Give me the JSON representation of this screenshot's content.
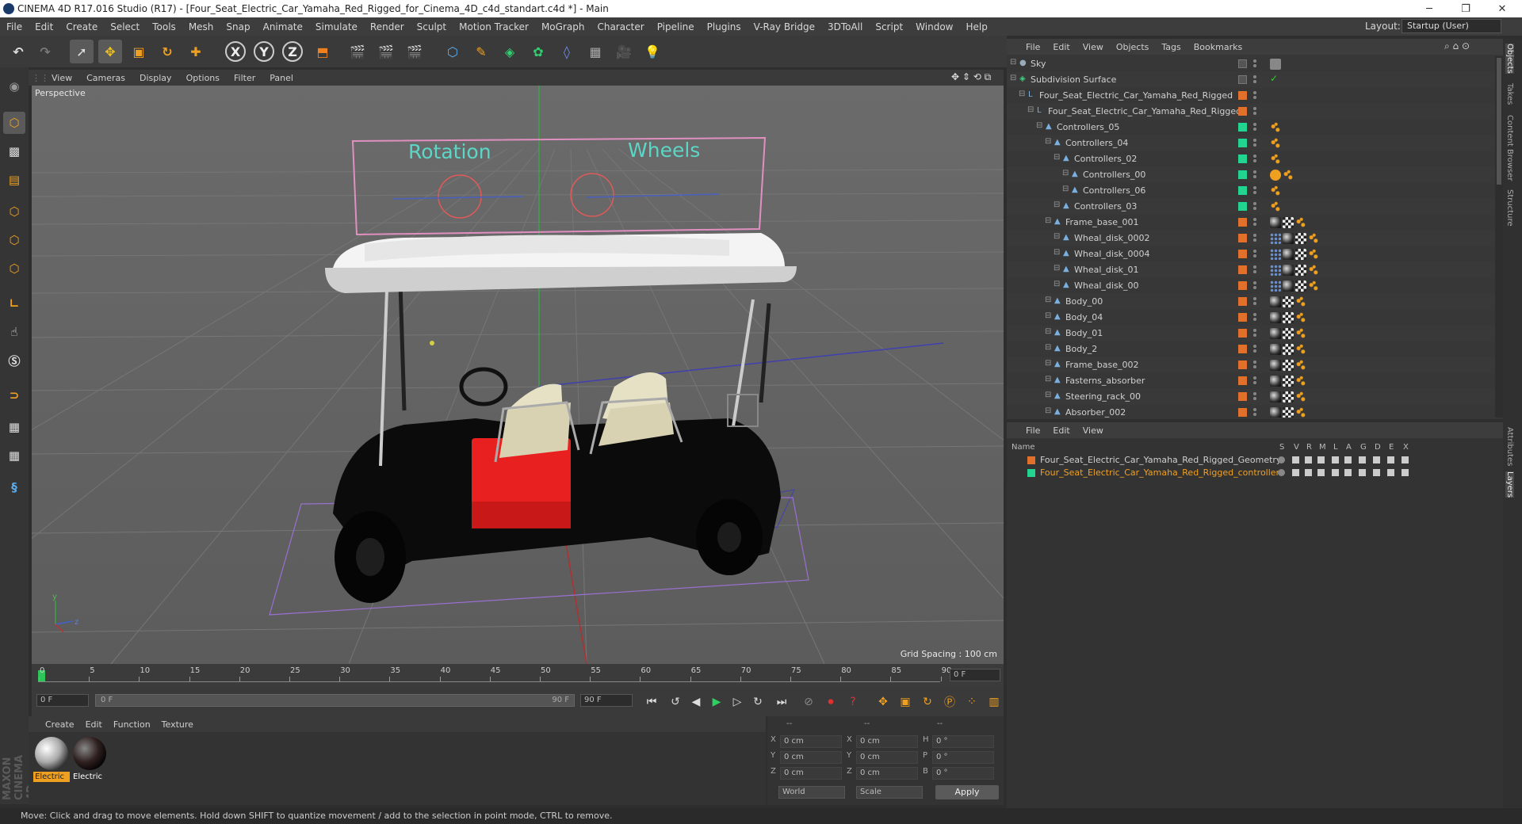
{
  "window": {
    "title": "CINEMA 4D R17.016 Studio (R17) - [Four_Seat_Electric_Car_Yamaha_Red_Rigged_for_Cinema_4D_c4d_standart.c4d *] - Main",
    "minimize": "─",
    "restore": "❐",
    "close": "✕"
  },
  "menubar": {
    "items": [
      "File",
      "Edit",
      "Create",
      "Select",
      "Tools",
      "Mesh",
      "Snap",
      "Animate",
      "Simulate",
      "Render",
      "Sculpt",
      "Motion Tracker",
      "MoGraph",
      "Character",
      "Pipeline",
      "Plugins",
      "V-Ray Bridge",
      "3DToAll",
      "Script",
      "Window",
      "Help"
    ],
    "layout_label": "Layout:",
    "layout_value": "Startup (User)"
  },
  "viewport": {
    "menu": [
      "View",
      "Cameras",
      "Display",
      "Options",
      "Filter",
      "Panel"
    ],
    "label": "Perspective",
    "grid_spacing": "Grid Spacing : 100 cm",
    "overlay_text_1": "Rotation",
    "overlay_text_2": "Wheels",
    "axis_y": "y",
    "axis_z": "z"
  },
  "timeline": {
    "ticks": [
      "0",
      "5",
      "10",
      "15",
      "20",
      "25",
      "30",
      "35",
      "40",
      "45",
      "50",
      "55",
      "60",
      "65",
      "70",
      "75",
      "80",
      "85",
      "90"
    ],
    "end_field": "0 F"
  },
  "transport": {
    "start": "0 F",
    "range_start": "0 F",
    "range_end": "90 F",
    "end": "90 F"
  },
  "materials": {
    "menu": [
      "Create",
      "Edit",
      "Function",
      "Texture"
    ],
    "items": [
      {
        "label": "Electric"
      },
      {
        "label": "Electric"
      }
    ]
  },
  "coords": {
    "headers": [
      "--",
      "--",
      "--"
    ],
    "rows": [
      {
        "a": "X",
        "v1": "0 cm",
        "b": "X",
        "v2": "0 cm",
        "c": "H",
        "v3": "0 °"
      },
      {
        "a": "Y",
        "v1": "0 cm",
        "b": "Y",
        "v2": "0 cm",
        "c": "P",
        "v3": "0 °"
      },
      {
        "a": "Z",
        "v1": "0 cm",
        "b": "Z",
        "v2": "0 cm",
        "c": "B",
        "v3": "0 °"
      }
    ],
    "world": "World",
    "scale": "Scale",
    "apply": "Apply"
  },
  "objects": {
    "menu": [
      "File",
      "Edit",
      "View",
      "Objects",
      "Tags",
      "Bookmarks"
    ],
    "rows": [
      {
        "name": "Sky",
        "indent": 0,
        "layer": "",
        "tags": [
          "sky"
        ]
      },
      {
        "name": "Subdivision Surface",
        "indent": 0,
        "layer": "",
        "tags": [
          "check"
        ]
      },
      {
        "name": "Four_Seat_Electric_Car_Yamaha_Red_Rigged",
        "indent": 1,
        "layer": "#e0702a",
        "tags": []
      },
      {
        "name": "Four_Seat_Electric_Car_Yamaha_Red_Rigged",
        "indent": 2,
        "layer": "#e0702a",
        "tags": []
      },
      {
        "name": "Controllers_05",
        "indent": 3,
        "layer": "#22d48f",
        "tags": [
          "dots"
        ]
      },
      {
        "name": "Controllers_04",
        "indent": 4,
        "layer": "#22d48f",
        "tags": [
          "dots"
        ]
      },
      {
        "name": "Controllers_02",
        "indent": 5,
        "layer": "#22d48f",
        "tags": [
          "dots"
        ]
      },
      {
        "name": "Controllers_00",
        "indent": 6,
        "layer": "#22d48f",
        "tags": [
          "no",
          "dots"
        ]
      },
      {
        "name": "Controllers_06",
        "indent": 6,
        "layer": "#22d48f",
        "tags": [
          "dots"
        ]
      },
      {
        "name": "Controllers_03",
        "indent": 5,
        "layer": "#22d48f",
        "tags": [
          "dots"
        ]
      },
      {
        "name": "Frame_base_001",
        "indent": 4,
        "layer": "#e0702a",
        "tags": [
          "mat",
          "chk",
          "dots"
        ]
      },
      {
        "name": "Wheal_disk_0002",
        "indent": 5,
        "layer": "#e0702a",
        "tags": [
          "xp",
          "mat",
          "chk",
          "dots"
        ]
      },
      {
        "name": "Wheal_disk_0004",
        "indent": 5,
        "layer": "#e0702a",
        "tags": [
          "xp",
          "mat",
          "chk",
          "dots"
        ]
      },
      {
        "name": "Wheal_disk_01",
        "indent": 5,
        "layer": "#e0702a",
        "tags": [
          "xp",
          "mat",
          "chk",
          "dots"
        ]
      },
      {
        "name": "Wheal_disk_00",
        "indent": 5,
        "layer": "#e0702a",
        "tags": [
          "xp",
          "mat",
          "chk",
          "dots"
        ]
      },
      {
        "name": "Body_00",
        "indent": 4,
        "layer": "#e0702a",
        "tags": [
          "mat",
          "chk",
          "dots"
        ]
      },
      {
        "name": "Body_04",
        "indent": 4,
        "layer": "#e0702a",
        "tags": [
          "mat",
          "chk",
          "dots"
        ]
      },
      {
        "name": "Body_01",
        "indent": 4,
        "layer": "#e0702a",
        "tags": [
          "mat",
          "chk",
          "dots"
        ]
      },
      {
        "name": "Body_2",
        "indent": 4,
        "layer": "#e0702a",
        "tags": [
          "mat",
          "chk",
          "dots"
        ]
      },
      {
        "name": "Frame_base_002",
        "indent": 4,
        "layer": "#e0702a",
        "tags": [
          "mat",
          "chk",
          "dots"
        ]
      },
      {
        "name": "Fasterns_absorber",
        "indent": 4,
        "layer": "#e0702a",
        "tags": [
          "mat",
          "chk",
          "dots"
        ]
      },
      {
        "name": "Steering_rack_00",
        "indent": 4,
        "layer": "#e0702a",
        "tags": [
          "mat",
          "chk",
          "dots"
        ]
      },
      {
        "name": "Absorber_002",
        "indent": 4,
        "layer": "#e0702a",
        "tags": [
          "mat",
          "chk",
          "dots"
        ]
      }
    ]
  },
  "layers": {
    "menu": [
      "File",
      "Edit",
      "View"
    ],
    "headers": [
      "Name",
      "S",
      "V",
      "R",
      "M",
      "L",
      "A",
      "G",
      "D",
      "E",
      "X"
    ],
    "rows": [
      {
        "name": "Four_Seat_Electric_Car_Yamaha_Red_Rigged_Geometry",
        "color": "#e0702a",
        "text_color": "#d0d0d0"
      },
      {
        "name": "Four_Seat_Electric_Car_Yamaha_Red_Rigged_controllers",
        "color": "#22d48f",
        "text_color": "#f2a020"
      }
    ]
  },
  "right_tabs": [
    "Objects",
    "Takes",
    "Content Browser",
    "Structure",
    "Attributes",
    "Layers"
  ],
  "status": "Move: Click and drag to move elements. Hold down SHIFT to quantize movement / add to the selection in point mode, CTRL to remove.",
  "logo": "MAXON CINEMA 4D"
}
